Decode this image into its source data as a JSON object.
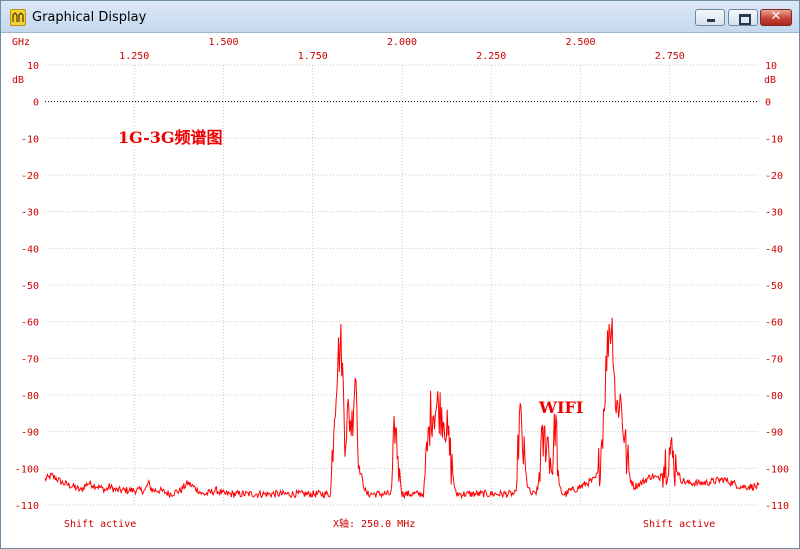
{
  "window": {
    "title": "Graphical Display",
    "icon": "display-app-icon",
    "controls": {
      "minimize": "minimize-icon",
      "maximize": "maximize-icon",
      "close_glyph": "✕"
    }
  },
  "colors": {
    "trace": "#ff0000",
    "labels": "#cc0000",
    "grid": "#c8c8c8",
    "reference_line": "#000000"
  },
  "chart_data": {
    "type": "line",
    "top_axis_unit": "GHz",
    "left_axis_unit": "dB",
    "right_axis_unit": "dB",
    "x_major_ticks": [
      "1.500",
      "2.000",
      "2.500"
    ],
    "x_minor_ticks": [
      "1.250",
      "1.750",
      "2.250",
      "2.750"
    ],
    "xlim": [
      1.0,
      3.0
    ],
    "ylim": [
      -110,
      10
    ],
    "y_ticks": [
      10,
      0,
      -10,
      -20,
      -30,
      -40,
      -50,
      -60,
      -70,
      -80,
      -90,
      -100,
      -110
    ],
    "grid": true,
    "reference_level_db": 0,
    "annotations": [
      "1G-3G频谱图",
      "WIFI"
    ],
    "footer": {
      "left": "Shift active",
      "center": "X轴: 250.0 MHz",
      "right": "Shift active"
    },
    "series": [
      {
        "x": [
          1.0,
          1.02,
          1.05,
          1.08,
          1.1,
          1.12,
          1.15,
          1.17,
          1.18,
          1.2,
          1.22,
          1.25,
          1.28,
          1.29,
          1.3,
          1.32,
          1.35,
          1.38,
          1.4,
          1.43,
          1.44,
          1.45,
          1.48,
          1.5,
          1.55,
          1.6,
          1.65,
          1.7,
          1.75,
          1.78,
          1.8,
          1.81,
          1.82,
          1.83,
          1.84,
          1.85,
          1.86,
          1.87,
          1.88,
          1.9,
          1.92,
          1.93,
          1.94,
          1.95,
          1.97,
          1.98,
          2.0,
          2.02,
          2.03,
          2.04,
          2.06,
          2.08,
          2.1,
          2.12,
          2.15,
          2.18,
          2.2,
          2.22,
          2.25,
          2.28,
          2.32,
          2.33,
          2.34,
          2.35,
          2.36,
          2.37,
          2.38,
          2.39,
          2.4,
          2.41,
          2.42,
          2.43,
          2.44,
          2.45,
          2.46,
          2.47,
          2.48,
          2.5,
          2.52,
          2.54,
          2.55,
          2.56,
          2.57,
          2.58,
          2.59,
          2.6,
          2.61,
          2.62,
          2.63,
          2.64,
          2.65,
          2.67,
          2.7,
          2.72,
          2.73,
          2.75,
          2.78,
          2.8,
          2.85,
          2.9,
          2.95,
          3.0
        ],
        "y": [
          -103,
          -102,
          -104,
          -105,
          -106,
          -104,
          -105,
          -106,
          -105,
          -106,
          -106,
          -106,
          -106,
          -104,
          -106,
          -106,
          -107,
          -106,
          -104,
          -106,
          -107,
          -107,
          -106,
          -107,
          -107,
          -107,
          -107,
          -107,
          -107,
          -107,
          -107,
          -85,
          -70,
          -66,
          -90,
          -85,
          -88,
          -72,
          -100,
          -107,
          -107,
          -107,
          -107,
          -107,
          -107,
          -88,
          -107,
          -107,
          -107,
          -107,
          -107,
          -85,
          -83,
          -86,
          -107,
          -107,
          -107,
          -107,
          -107,
          -107,
          -107,
          -85,
          -96,
          -104,
          -107,
          -107,
          -106,
          -95,
          -92,
          -93,
          -101,
          -86,
          -105,
          -107,
          -107,
          -106,
          -106,
          -105,
          -104,
          -103,
          -101,
          -92,
          -75,
          -61,
          -62,
          -85,
          -80,
          -88,
          -98,
          -103,
          -105,
          -104,
          -102,
          -103,
          -100,
          -95,
          -103,
          -104,
          -104,
          -103,
          -105,
          -105
        ]
      }
    ]
  }
}
